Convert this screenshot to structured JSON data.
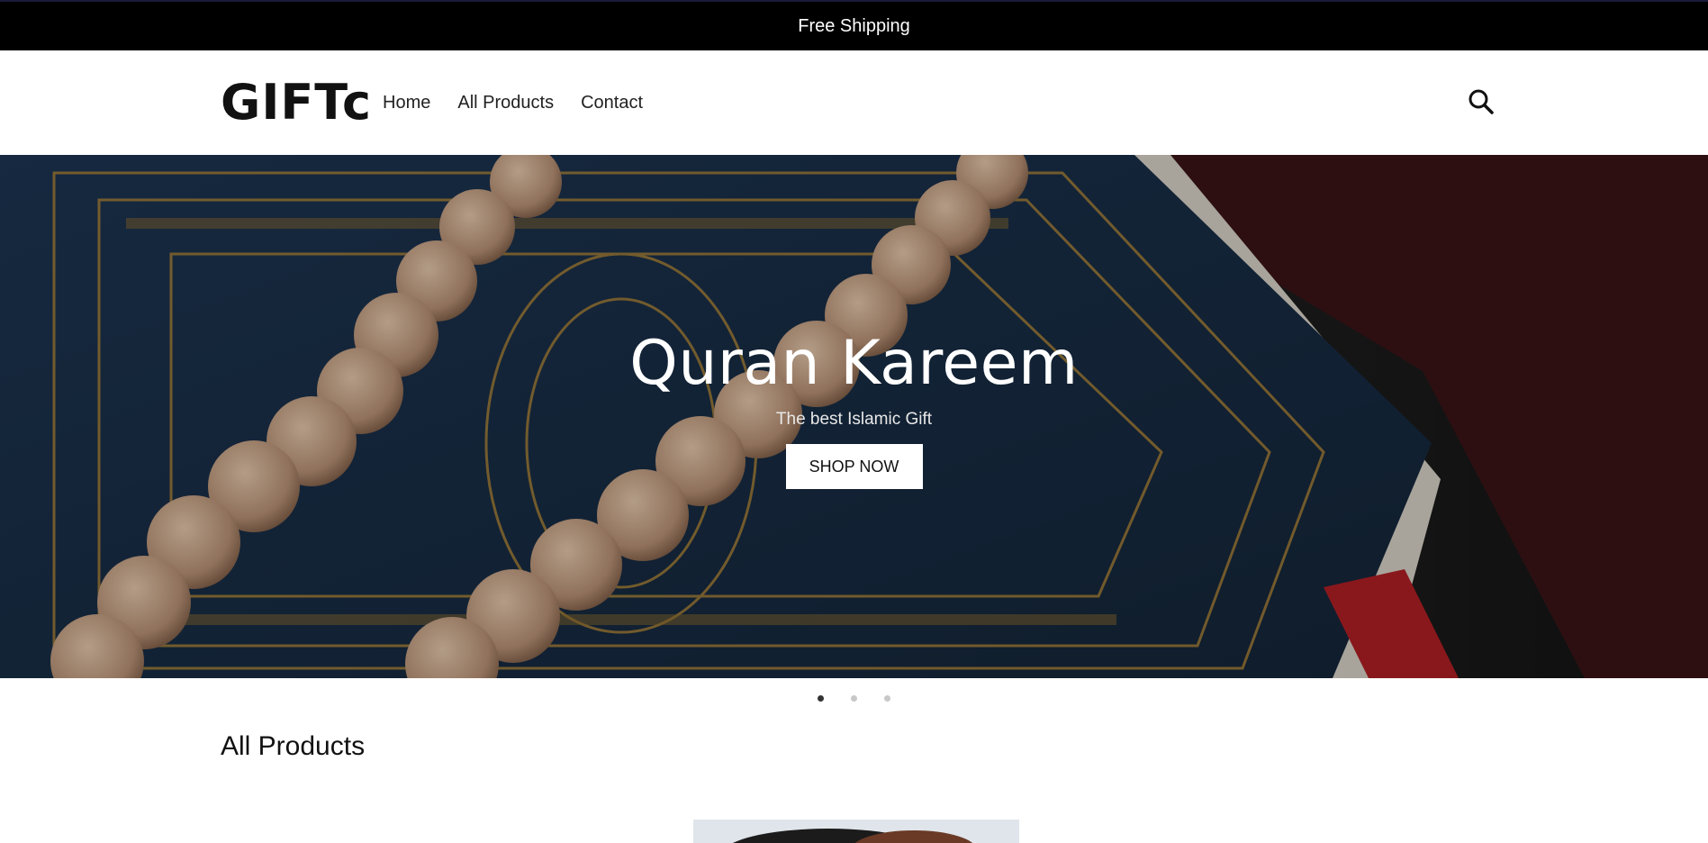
{
  "announcement": {
    "text": "Free Shipping"
  },
  "header": {
    "logo": "GIFTc",
    "nav": [
      "Home",
      "All Products",
      "Contact"
    ],
    "search_icon": "search-icon"
  },
  "hero": {
    "title": "Quran Kareem",
    "subtitle": "The best Islamic Gift",
    "button": "SHOP NOW",
    "slides_total": 3,
    "active_slide": 1
  },
  "products": {
    "section_title": "All Products"
  },
  "colors": {
    "announcement_bg": "#000000",
    "hero_book": "#1f3a5a",
    "gold": "#b8913a",
    "beads": "#cfa98a"
  }
}
